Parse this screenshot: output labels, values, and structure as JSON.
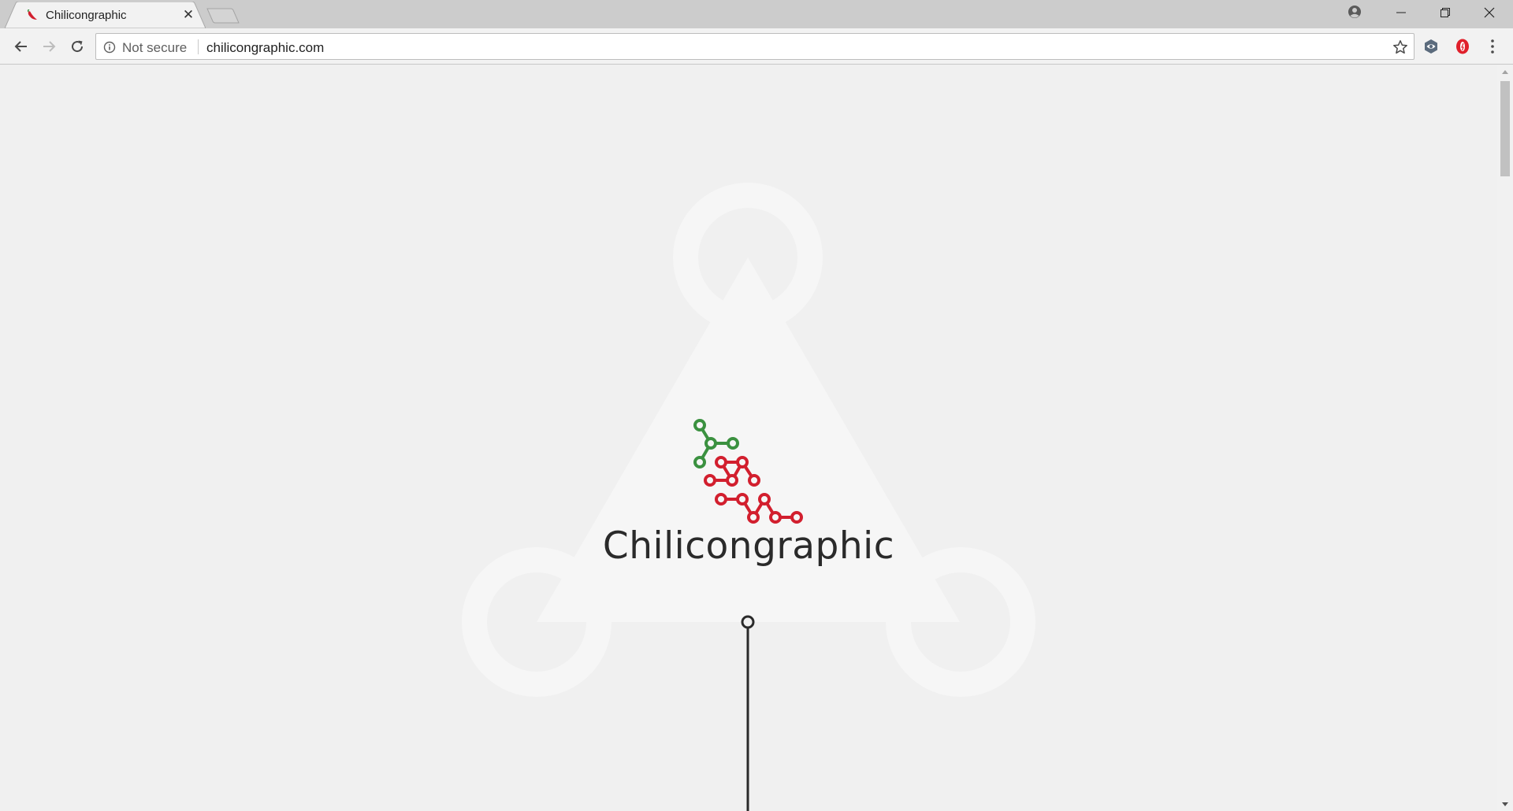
{
  "browser": {
    "tab": {
      "title": "Chilicongraphic",
      "close_glyph": "✕",
      "favicon": "chili-favicon"
    },
    "window_controls": [
      "minimize-icon",
      "restore-icon",
      "close-icon"
    ],
    "profile_icon": "profile-icon"
  },
  "toolbar": {
    "back_icon": "back-arrow-icon",
    "forward_icon": "forward-arrow-icon",
    "reload_icon": "reload-icon",
    "security_icon": "info-icon",
    "security_label": "Not secure",
    "url": "chilicongraphic.com",
    "bookmark_icon": "star-icon",
    "extensions": [
      "eye-extension-icon",
      "opera-extension-icon"
    ],
    "menu_icon": "more-vertical-icon"
  },
  "page": {
    "brand_name": "Chilicongraphic",
    "colors": {
      "background": "#f0f0f0",
      "logo_green": "#3b9140",
      "logo_red": "#d21f2e",
      "text": "#2a2a2a"
    }
  }
}
